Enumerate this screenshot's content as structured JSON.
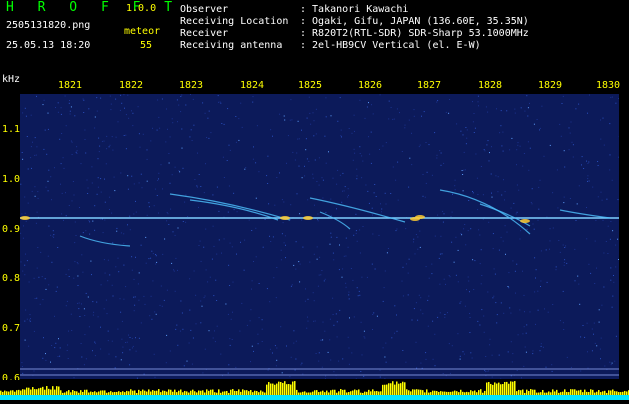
{
  "header": {
    "app_name": "H R O F F T",
    "version": "1.0.0",
    "filename": "2505131820.png",
    "mode_label": "meteor",
    "datetime": "25.05.13 18:20",
    "count": "55",
    "info": [
      {
        "key": "Observer",
        "value": ": Takanori Kawachi"
      },
      {
        "key": "Receiving Location",
        "value": ": Ogaki, Gifu, JAPAN (136.60E, 35.35N)"
      },
      {
        "key": "Receiver",
        "value": ": R820T2(RTL-SDR) SDR-Sharp 53.1000MHz"
      },
      {
        "key": "Receiving antenna",
        "value": ": 2el-HB9CV Vertical (el. E-W)"
      }
    ]
  },
  "spectrogram": {
    "y_unit": "kHz",
    "x_ticks": [
      "1821",
      "1822",
      "1823",
      "1824",
      "1825",
      "1826",
      "1827",
      "1828",
      "1829",
      "1830"
    ],
    "y_ticks": [
      "1.1",
      "1.0",
      "0.9",
      "0.8",
      "0.7",
      "0.6"
    ],
    "colors": {
      "background": "#0c1a5a",
      "tick_labels": "#ffff00",
      "carrier": "#7fd0ff",
      "histogram": "#ffff00",
      "histogram_base": "#00e5ff"
    }
  }
}
